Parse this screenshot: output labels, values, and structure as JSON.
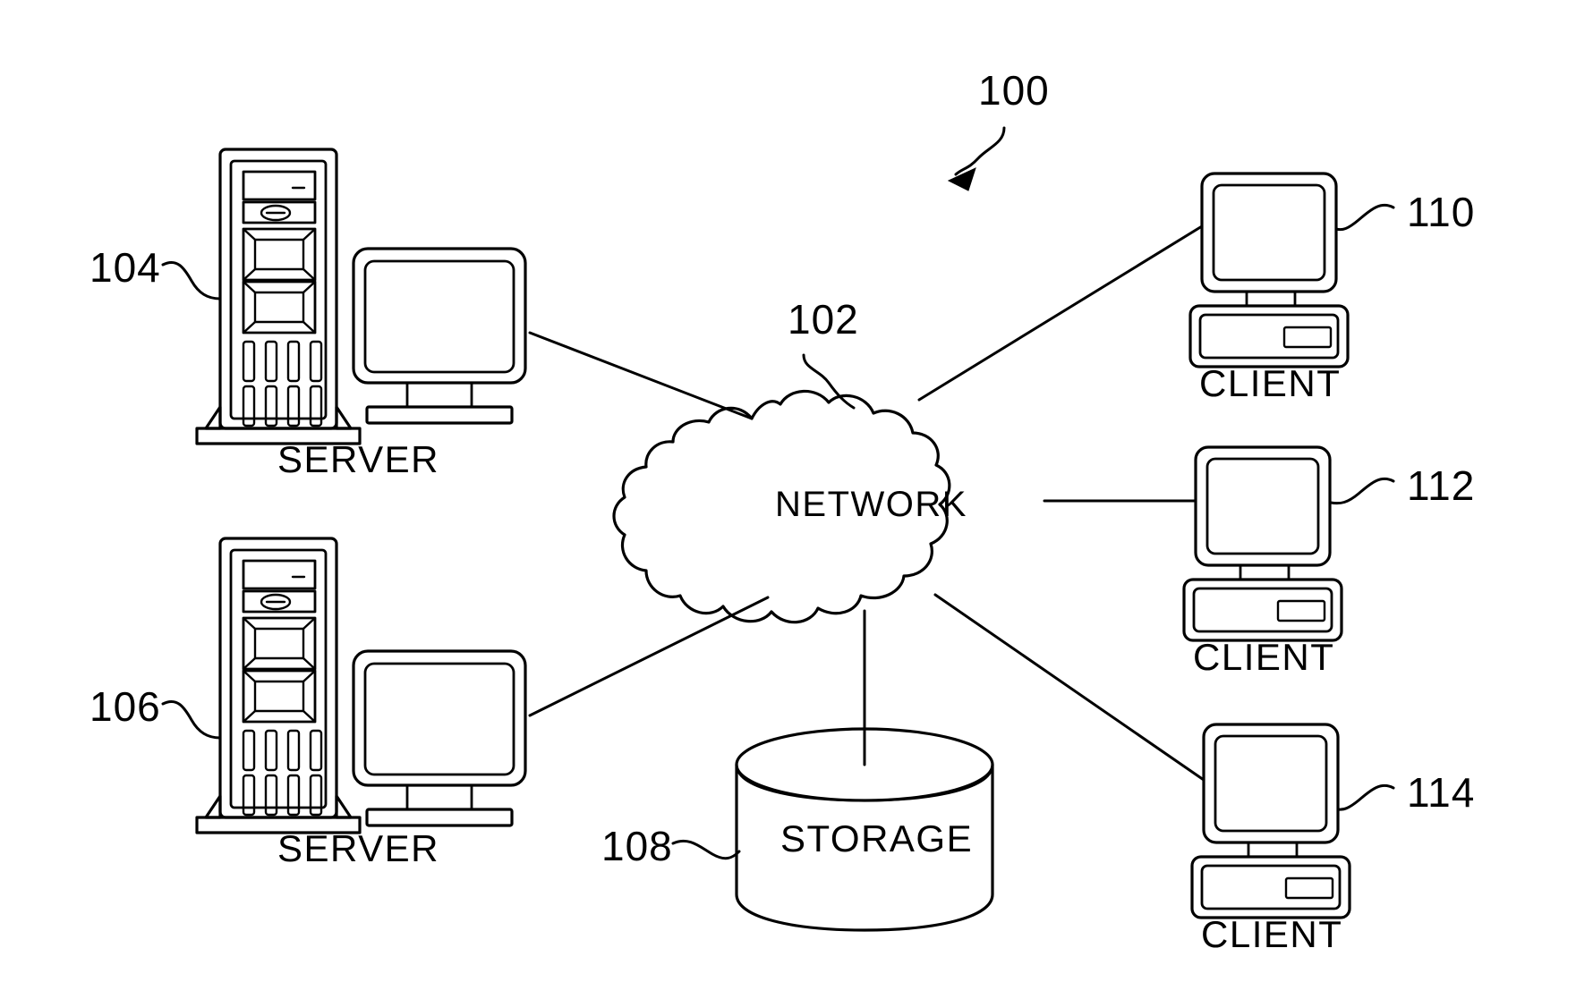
{
  "figure": {
    "kind": "network-topology-diagram",
    "style": "patent-line-drawing",
    "background_color": "#ffffff",
    "line_color": "#000000"
  },
  "figure_reference": {
    "number": "100",
    "name": "figure-callout",
    "has_arrow": true
  },
  "nodes": [
    {
      "id": "server-top",
      "ref": "104",
      "label": "SERVER",
      "icon": "server-tower-with-monitor-icon"
    },
    {
      "id": "server-bottom",
      "ref": "106",
      "label": "SERVER",
      "icon": "server-tower-with-monitor-icon"
    },
    {
      "id": "network-cloud",
      "ref": "102",
      "label": "NETWORK",
      "icon": "cloud-icon"
    },
    {
      "id": "storage",
      "ref": "108",
      "label": "STORAGE",
      "icon": "cylinder-database-icon"
    },
    {
      "id": "client-top",
      "ref": "110",
      "label": "CLIENT",
      "icon": "desktop-computer-icon"
    },
    {
      "id": "client-middle",
      "ref": "112",
      "label": "CLIENT",
      "icon": "desktop-computer-icon"
    },
    {
      "id": "client-bottom",
      "ref": "114",
      "label": "CLIENT",
      "icon": "desktop-computer-icon"
    }
  ],
  "connections": [
    {
      "from": "server-top",
      "to": "network-cloud"
    },
    {
      "from": "server-bottom",
      "to": "network-cloud"
    },
    {
      "from": "network-cloud",
      "to": "storage"
    },
    {
      "from": "network-cloud",
      "to": "client-top"
    },
    {
      "from": "network-cloud",
      "to": "client-middle"
    },
    {
      "from": "network-cloud",
      "to": "client-bottom"
    }
  ],
  "labels": {
    "ref_100": "100",
    "ref_102": "102",
    "ref_104": "104",
    "ref_106": "106",
    "ref_108": "108",
    "ref_110": "110",
    "ref_112": "112",
    "ref_114": "114",
    "network": "NETWORK",
    "storage": "STORAGE",
    "server_top": "SERVER",
    "server_bottom": "SERVER",
    "client_top": "CLIENT",
    "client_middle": "CLIENT",
    "client_bottom": "CLIENT"
  }
}
